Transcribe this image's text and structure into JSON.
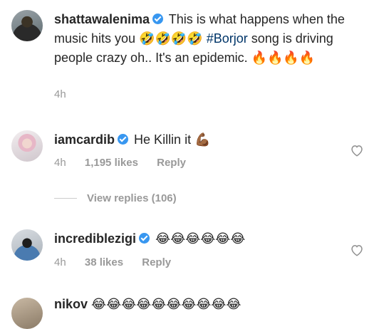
{
  "caption": {
    "username": "shattawalenima",
    "text_before": " This is what happens when the music hits you ",
    "emoji_laugh": "🤣🤣🤣🤣",
    "hashtag": "#Borjor",
    "text_after": " song is driving people crazy oh.. It's an epidemic. ",
    "emoji_fire": "🔥🔥🔥🔥",
    "time": "4h"
  },
  "comments": [
    {
      "username": "iamcardib",
      "text": " He Killin it ",
      "emoji": "💪🏾",
      "time": "4h",
      "likes": "1,195 likes",
      "reply": "Reply"
    },
    {
      "username": "incrediblezigi",
      "text": " ",
      "emoji": "😂😂😂😂😂😂",
      "time": "4h",
      "likes": "38 likes",
      "reply": "Reply"
    },
    {
      "username": "nikov",
      "text": " ",
      "emoji": "😂😂😂😂😂😂😂😂😂😂"
    }
  ],
  "view_replies": "View replies (106)",
  "colors": {
    "verified": "#3897f0",
    "hashtag": "#003569",
    "meta": "#999999"
  }
}
